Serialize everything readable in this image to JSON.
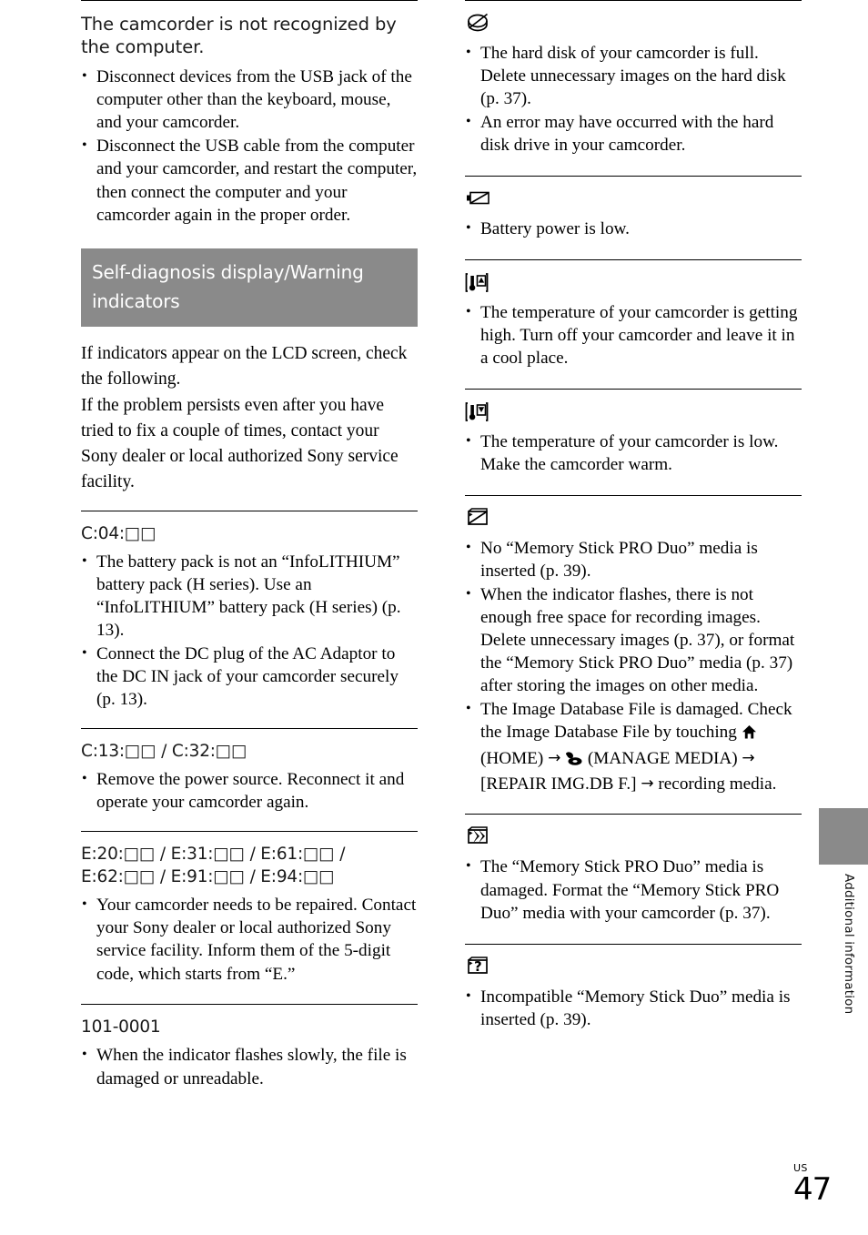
{
  "page": {
    "folio_label": "US",
    "folio_number": "47",
    "side_tab_label": "Additional information",
    "accent_gray": "#8a8a8a"
  },
  "left_column": {
    "question_heading": "The camcorder is not recognized by the computer.",
    "question_bullets": [
      "Disconnect devices from the USB jack of the computer other than the keyboard, mouse, and your camcorder.",
      "Disconnect the USB cable from the computer and your camcorder, and restart the computer, then connect the computer and your camcorder again in the proper order."
    ],
    "banner_title": "Self-diagnosis display/Warning indicators",
    "intro_paragraph": "If indicators appear on the LCD screen, check the following.\nIf the problem persists even after you have tried to fix a couple of times, contact your Sony dealer or local authorized Sony service facility.",
    "sections": [
      {
        "code": "C:04:□□",
        "bullets": [
          "The battery pack is not an “InfoLITHIUM” battery pack (H series). Use an “InfoLITHIUM” battery pack (H series) (p. 13).",
          "Connect the DC plug of the AC Adaptor to the DC IN jack of your camcorder securely (p. 13)."
        ]
      },
      {
        "code": "C:13:□□ / C:32:□□",
        "bullets": [
          "Remove the power source. Reconnect it and operate your camcorder again."
        ]
      },
      {
        "code": "E:20:□□ / E:31:□□ / E:61:□□ / E:62:□□ / E:91:□□ / E:94:□□",
        "bullets": [
          "Your camcorder needs to be repaired. Contact your Sony dealer or local authorized Sony service facility. Inform them of the 5-digit code, which starts from “E.”"
        ]
      },
      {
        "code": "101-0001",
        "bullets": [
          "When the indicator flashes slowly, the file is damaged or unreadable."
        ]
      }
    ]
  },
  "right_column": {
    "sections": [
      {
        "icon": "hard-disk-full-icon",
        "bullets": [
          "The hard disk of your camcorder is full. Delete unnecessary images on the hard disk (p. 37).",
          "An error may have occurred with the hard disk drive in your camcorder."
        ]
      },
      {
        "icon": "battery-low-icon",
        "bullets": [
          "Battery power is low."
        ]
      },
      {
        "icon": "temperature-high-icon",
        "bullets": [
          "The temperature of your camcorder is getting high. Turn off your camcorder and leave it in a cool place."
        ]
      },
      {
        "icon": "temperature-low-icon",
        "bullets": [
          "The temperature of your camcorder is low. Make the camcorder warm."
        ]
      },
      {
        "icon": "no-memory-stick-icon",
        "bullets": [
          "No “Memory Stick PRO Duo” media is inserted (p. 39).",
          "When the indicator flashes, there is not enough free space for recording images. Delete unnecessary images (p. 37), or format the “Memory Stick PRO Duo” media (p. 37) after storing the images on other media."
        ],
        "rich_bullet": {
          "pre": "The Image Database File is damaged. Check the Image Database File by touching ",
          "home_label": " (HOME) ",
          "manage_label": " (MANAGE MEDIA) ",
          "post": "[REPAIR IMG.DB F.] ",
          "tail": " recording media.",
          "arrow": "→"
        }
      },
      {
        "icon": "memory-stick-damaged-icon",
        "bullets": [
          "The “Memory Stick PRO Duo” media is damaged. Format the “Memory Stick PRO Duo” media with your camcorder (p. 37)."
        ]
      },
      {
        "icon": "memory-stick-incompatible-icon",
        "bullets": [
          "Incompatible “Memory Stick Duo” media is inserted (p. 39)."
        ]
      }
    ]
  }
}
